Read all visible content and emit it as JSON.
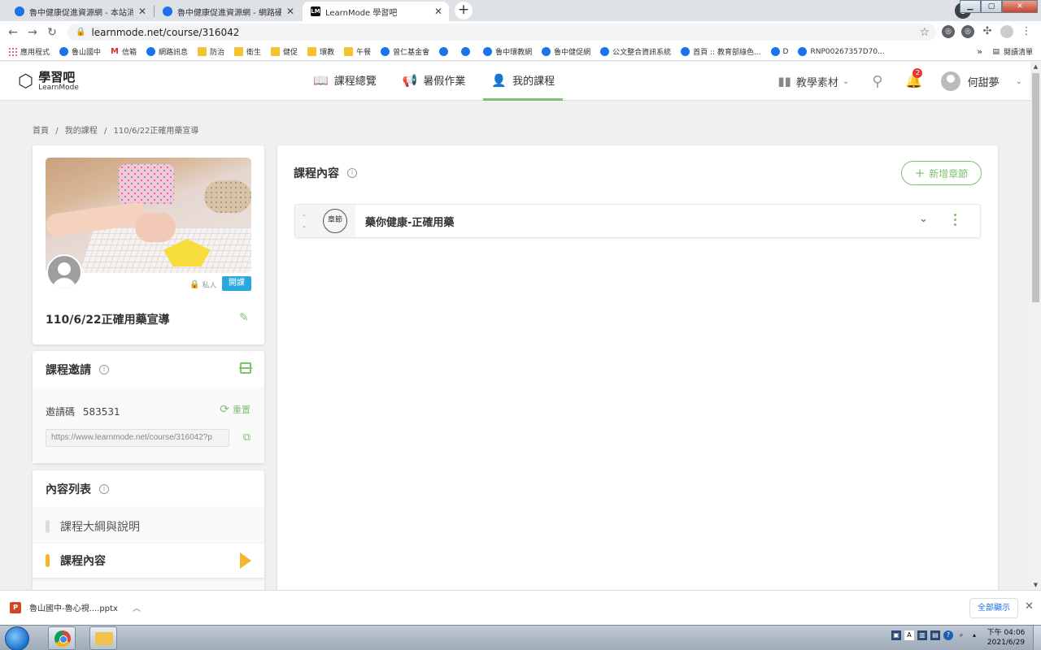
{
  "browser": {
    "tabs": [
      {
        "title": "魯中健康促進資源網 - 本站消息",
        "active": false
      },
      {
        "title": "魯中健康促進資源網 - 網路硬碟",
        "active": false
      },
      {
        "title": "LearnMode 學習吧",
        "active": true
      }
    ],
    "url": "learnmode.net/course/316042",
    "bookmarks": [
      {
        "label": "應用程式",
        "icon": "apps-icon"
      },
      {
        "label": "魯山國中",
        "icon": "globe-icon"
      },
      {
        "label": "信箱",
        "icon": "gmail-icon"
      },
      {
        "label": "網路訊息",
        "icon": "globe-icon"
      },
      {
        "label": "防治",
        "icon": "folder-icon"
      },
      {
        "label": "衛生",
        "icon": "folder-icon"
      },
      {
        "label": "健促",
        "icon": "folder-icon"
      },
      {
        "label": "環教",
        "icon": "folder-icon"
      },
      {
        "label": "午餐",
        "icon": "folder-icon"
      },
      {
        "label": "曾仁基金會",
        "icon": "globe-icon"
      },
      {
        "label": "",
        "icon": "globe-icon"
      },
      {
        "label": "",
        "icon": "globe-icon"
      },
      {
        "label": "魯中環教網",
        "icon": "globe-icon"
      },
      {
        "label": "魯中健促網",
        "icon": "globe-icon"
      },
      {
        "label": "公文整合資訊系統",
        "icon": "globe-icon"
      },
      {
        "label": "首頁 :: 教育部綠色...",
        "icon": "globe-icon"
      },
      {
        "label": "D",
        "icon": "globe-icon"
      },
      {
        "label": "RNP00267357D70...",
        "icon": "globe-icon"
      }
    ],
    "bookmarks_more": "»",
    "reading_list": "閱讀清單"
  },
  "site": {
    "logo_text": "學習吧",
    "logo_sub": "LearnMode",
    "nav": [
      {
        "label": "課程總覽",
        "icon": "book-icon",
        "active": false
      },
      {
        "label": "暑假作業",
        "icon": "megaphone-icon",
        "active": false
      },
      {
        "label": "我的課程",
        "icon": "teacher-icon",
        "active": true
      }
    ],
    "teaching_materials": "教學素材",
    "notification_count": "2",
    "user_name": "何甜夢"
  },
  "breadcrumb": {
    "home": "首頁",
    "sep1": "/",
    "my_courses": "我的課程",
    "sep2": "/",
    "current": "110/6/22正確用藥宣導"
  },
  "course": {
    "privacy_label": "私人",
    "status_badge": "開課",
    "title": "110/6/22正確用藥宣導"
  },
  "invite": {
    "heading": "課程邀請",
    "code_label": "邀請碼",
    "code": "583531",
    "reset_label": "重置",
    "url": "https://www.learnmode.net/course/316042?p"
  },
  "content_list": {
    "heading": "內容列表",
    "items": [
      {
        "label": "課程大綱與說明",
        "active": false
      },
      {
        "label": "課程內容",
        "active": true
      }
    ]
  },
  "main": {
    "heading": "課程內容",
    "add_chapter_label": "新增章節",
    "chapters": [
      {
        "badge": "章節",
        "title": "藥你健康-正確用藥"
      }
    ]
  },
  "download": {
    "file_name": "魯山國中-魯心視....pptx",
    "show_all": "全部顯示"
  },
  "taskbar": {
    "time": "下午 04:06",
    "date": "2021/6/29"
  },
  "colors": {
    "accent_green": "#7cc36f",
    "badge_blue": "#29a8e0",
    "active_orange": "#f6b42c",
    "notification_red": "#e53935"
  }
}
